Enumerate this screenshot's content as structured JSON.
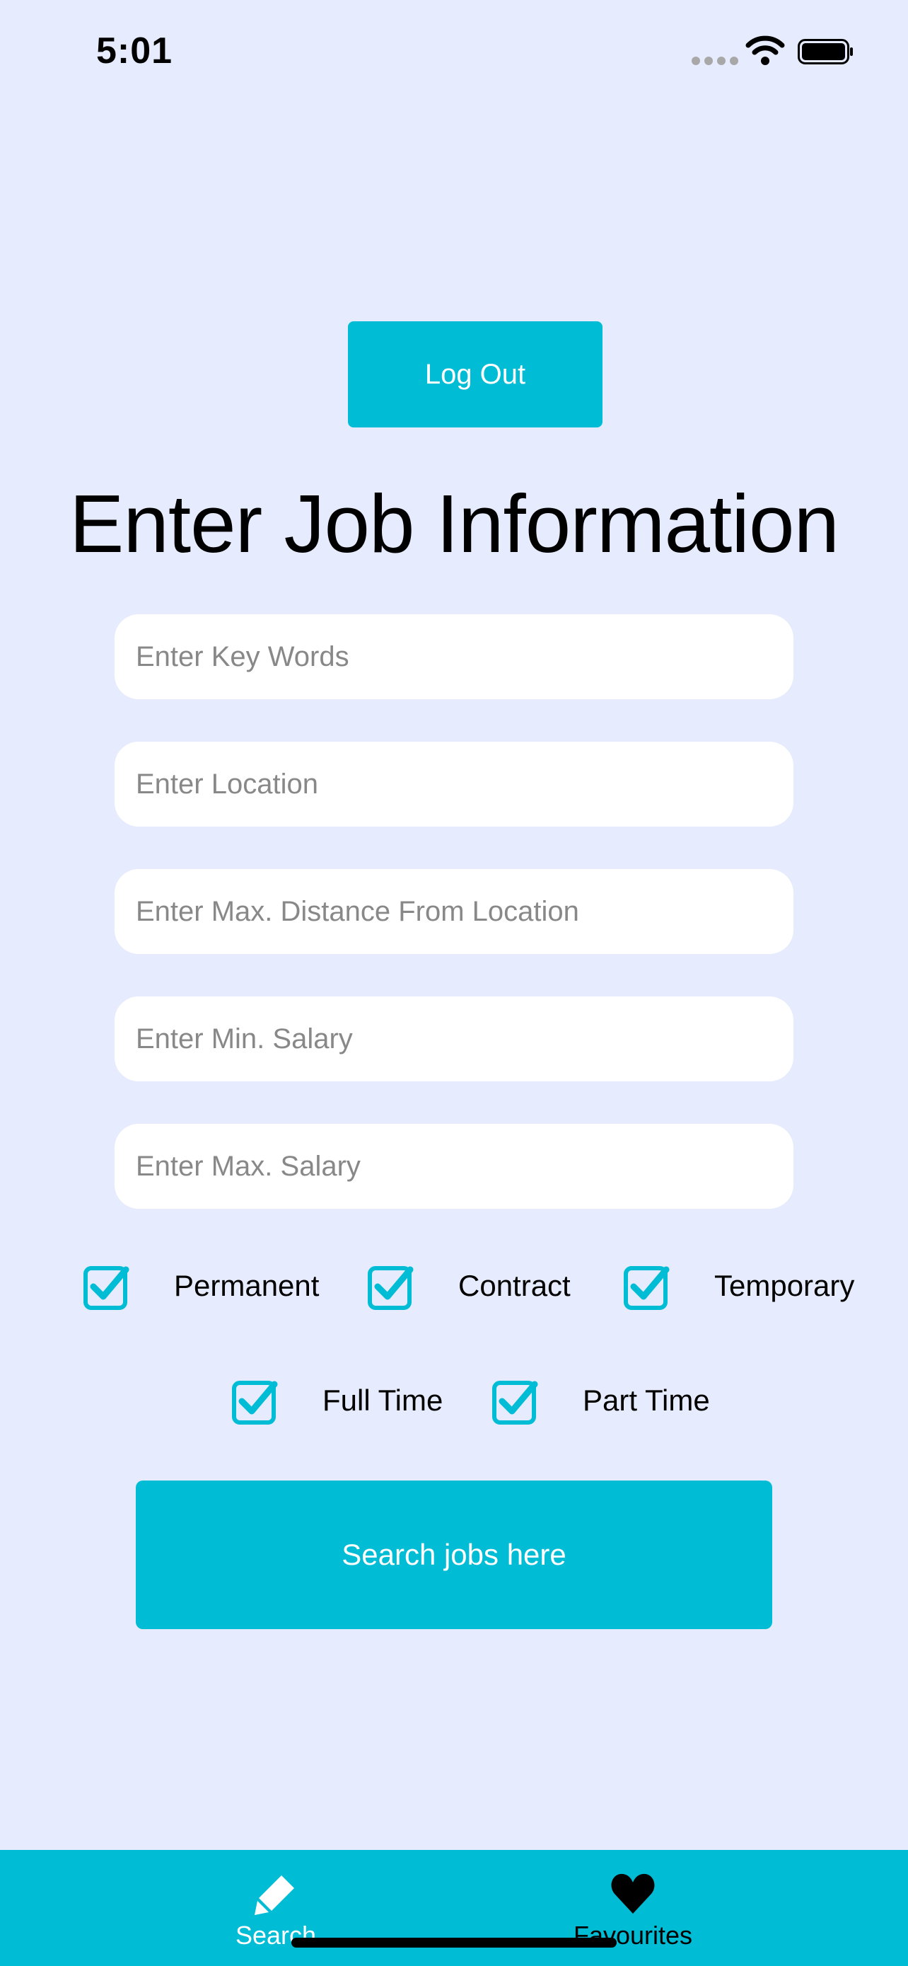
{
  "status_bar": {
    "time": "5:01"
  },
  "header": {
    "logout_label": "Log Out",
    "title": "Enter Job Information"
  },
  "form": {
    "keywords": {
      "placeholder": "Enter Key Words",
      "value": ""
    },
    "location": {
      "placeholder": "Enter Location",
      "value": ""
    },
    "distance": {
      "placeholder": "Enter Max. Distance From Location",
      "value": ""
    },
    "min_salary": {
      "placeholder": "Enter Min. Salary",
      "value": ""
    },
    "max_salary": {
      "placeholder": "Enter Max. Salary",
      "value": ""
    }
  },
  "job_types": [
    {
      "label": "Permanent",
      "checked": true
    },
    {
      "label": "Contract",
      "checked": true
    },
    {
      "label": "Temporary",
      "checked": true
    }
  ],
  "hours": [
    {
      "label": "Full Time",
      "checked": true
    },
    {
      "label": "Part Time",
      "checked": true
    }
  ],
  "search_button_label": "Search jobs here",
  "tab_bar": {
    "items": [
      {
        "label": "Search",
        "icon": "pencil-icon",
        "active": true
      },
      {
        "label": "Favourites",
        "icon": "heart-icon",
        "active": false
      }
    ]
  },
  "colors": {
    "background": "#e6ebfd",
    "accent": "#00bcd4",
    "input_background": "#ffffff"
  }
}
